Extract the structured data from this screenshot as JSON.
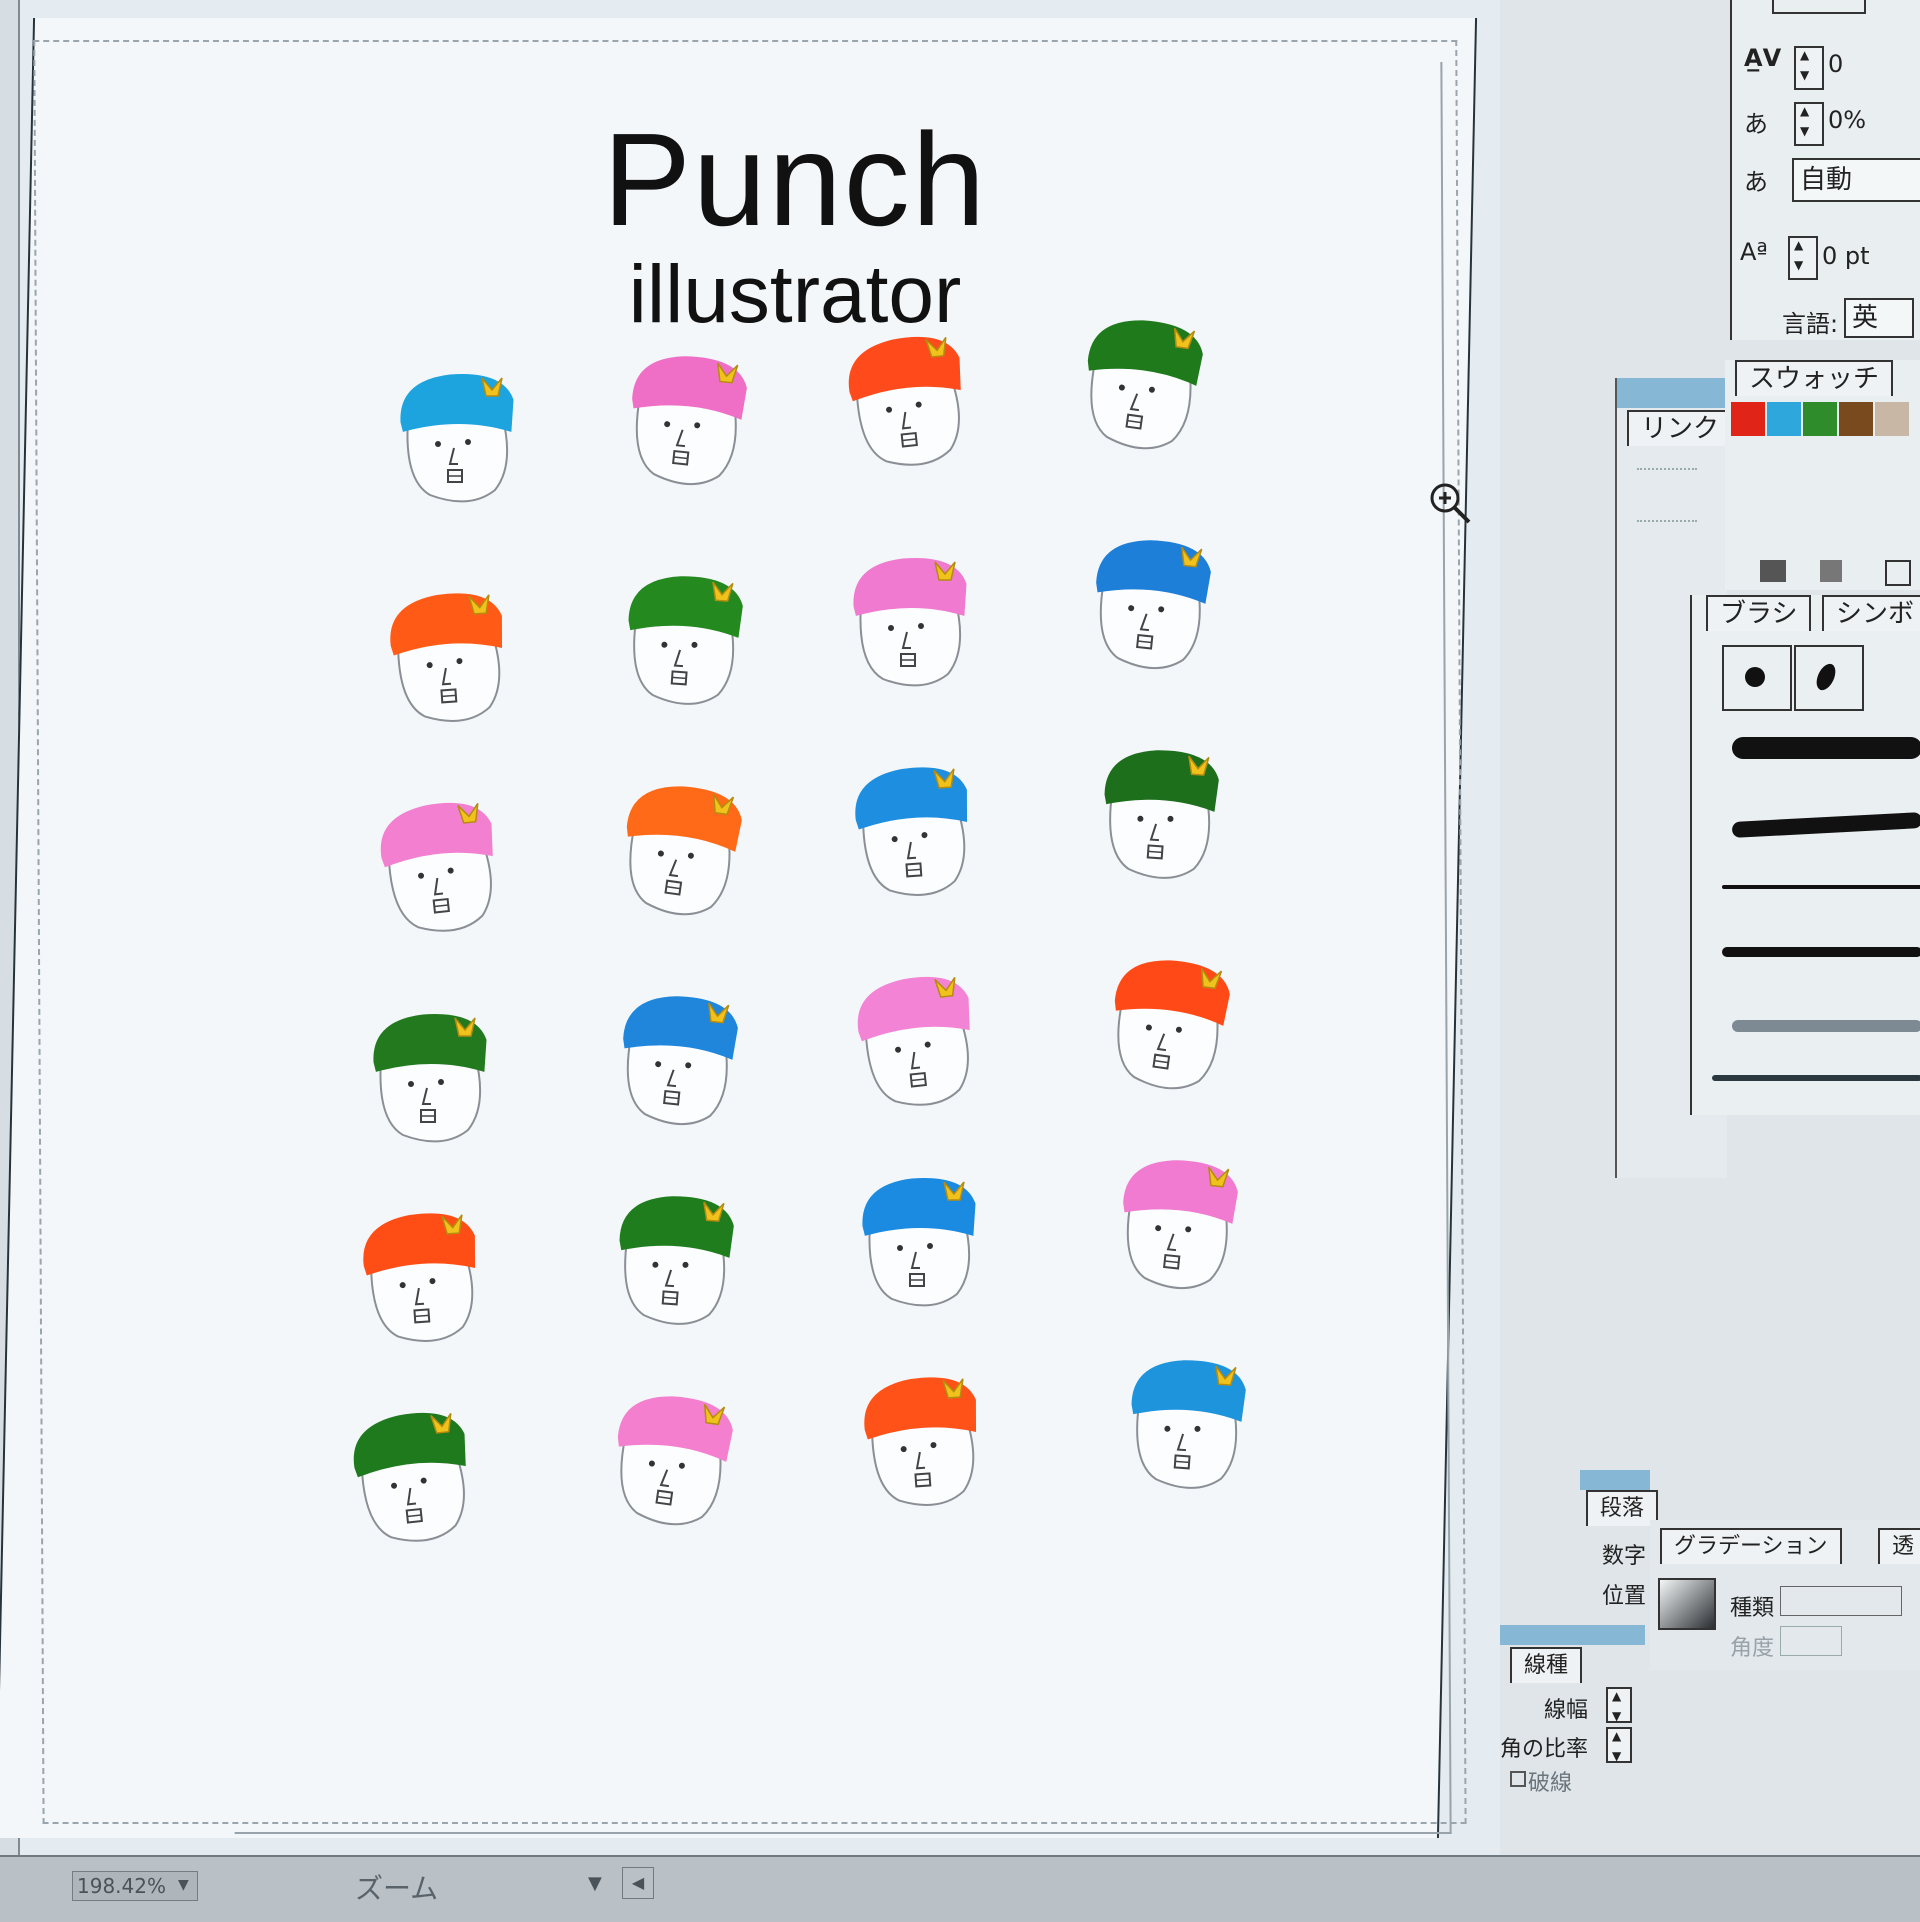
{
  "document": {
    "title": "Punch",
    "subtitle": "illustrator"
  },
  "faces": [
    {
      "hat": "#1da4de"
    },
    {
      "hat": "#ef6fc6"
    },
    {
      "hat": "#ff4b1c"
    },
    {
      "hat": "#1f7a1c"
    },
    {
      "hat": "#ff5a16"
    },
    {
      "hat": "#248a1f"
    },
    {
      "hat": "#f07ad0"
    },
    {
      "hat": "#1e7fd8"
    },
    {
      "hat": "#f27fcf"
    },
    {
      "hat": "#ff6a18"
    },
    {
      "hat": "#1e8fe0"
    },
    {
      "hat": "#1d6f1c"
    },
    {
      "hat": "#237a1e"
    },
    {
      "hat": "#1f86dc"
    },
    {
      "hat": "#f383d4"
    },
    {
      "hat": "#ff4a17"
    },
    {
      "hat": "#ff4d16"
    },
    {
      "hat": "#1f7d1e"
    },
    {
      "hat": "#1a8be0"
    },
    {
      "hat": "#f07bd0"
    },
    {
      "hat": "#1f7a1e"
    },
    {
      "hat": "#f57fcf"
    },
    {
      "hat": "#ff5219"
    },
    {
      "hat": "#1e94dd"
    }
  ],
  "character_panel": {
    "tracking_value": "0",
    "tsume_value": "0%",
    "aki_value": "自動",
    "baseline_shift_value": "0 pt",
    "language_label": "言語:",
    "language_value": "英"
  },
  "links_panel": {
    "tab_label": "リンク"
  },
  "swatches_panel": {
    "tab_label": "スウォッチ",
    "swatches": [
      "#e02418",
      "#2ea8dc",
      "#2e8c2a",
      "#7a4a1f",
      "#c9b7a6"
    ]
  },
  "brush_panel": {
    "tab_brush": "ブラシ",
    "tab_symbol": "シンボ"
  },
  "paragraph_panel": {
    "tab_label": "段落",
    "number_label": "数字",
    "position_label": "位置"
  },
  "gradient_panel": {
    "tab_label": "グラデーション",
    "extra_tab": "透",
    "type_label": "種類",
    "angle_label": "角度"
  },
  "stroke_panel": {
    "tab_label": "線種",
    "weight_label": "線幅",
    "miter_label": "角の比率",
    "dash_label": "破線"
  },
  "status_bar": {
    "zoom_level": "198.42%",
    "label": "ズーム"
  }
}
